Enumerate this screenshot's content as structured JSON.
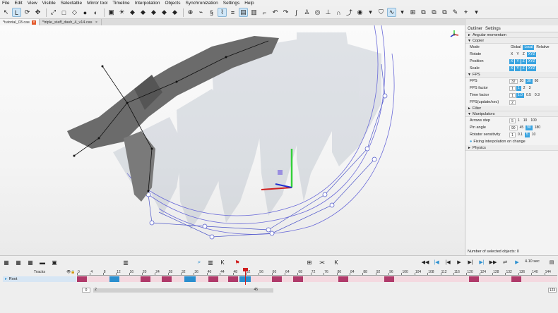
{
  "menu": [
    "File",
    "Edit",
    "View",
    "Visible",
    "Selectable",
    "Mirror tool",
    "Timeline",
    "Interpolation",
    "Objects",
    "Synchronization",
    "Settings",
    "Help"
  ],
  "toolbar_icons": [
    "select-icon",
    "lasso-icon",
    "rotate-icon",
    "move-icon",
    "scale-icon",
    "box-icon",
    "cube-icon",
    "sphere-icon",
    "mirror-icon",
    "camera-icon",
    "light-icon",
    "graph-icon",
    "curve-icon",
    "key-icon",
    "lock-icon",
    "chain-icon",
    "magnet-icon",
    "target-icon",
    "shield-icon",
    "wave-icon",
    "grid-icon",
    "layers-icon",
    "arrow-icon"
  ],
  "tabs": [
    {
      "label": "*tutorial_03.cas"
    },
    {
      "label": "*triple_staff_dash_4_v14.cas"
    }
  ],
  "panel": {
    "tabs": [
      "Outliner",
      "Settings"
    ],
    "sections": {
      "angular": "Angular momentum",
      "copier": "Copier",
      "fps": "FPS",
      "filter": "Filter",
      "manipulators": "Manipulators",
      "physics": "Physics"
    },
    "copier_rows": {
      "mode": {
        "label": "Mode",
        "opts": [
          "Global",
          "Local",
          "Relative"
        ]
      },
      "rotate": {
        "label": "Rotate",
        "opts": [
          "X",
          "Y",
          "Z",
          "XYZ"
        ]
      },
      "position": {
        "label": "Position",
        "opts": [
          "X",
          "Y",
          "Z",
          "XYZ"
        ]
      },
      "scale": {
        "label": "Scale",
        "opts": [
          "X",
          "Y",
          "Z",
          "XYZ"
        ]
      }
    },
    "fps_rows": {
      "fps": {
        "label": "FPS",
        "box": "32",
        "opts": [
          "20",
          "30",
          "60"
        ]
      },
      "factor": {
        "label": "FPS factor",
        "box": "1",
        "opts": [
          "1",
          "2",
          "3"
        ]
      },
      "time": {
        "label": "Time factor",
        "box": "1",
        "opts": [
          "1.0",
          "0.5",
          "0.3"
        ]
      },
      "update": {
        "label": "FPS(update/sec)",
        "box": "2"
      }
    },
    "manip_rows": {
      "arrows": {
        "label": "Arrows step",
        "box": "5",
        "opts": [
          "1",
          "10",
          "100"
        ]
      },
      "pin": {
        "label": "Pin angle",
        "box": "90",
        "opts": [
          "45",
          "90",
          "180"
        ]
      },
      "rot": {
        "label": "Rotator sensitivity",
        "box": "1",
        "opts": [
          "0.1",
          "5",
          "10"
        ]
      },
      "fixing": "Fixing interpolation on change"
    },
    "status": "Number of selected objects: 0"
  },
  "timeline": {
    "tracks_label": "Tracks",
    "root_label": "Root",
    "ticks": [
      "0",
      "4",
      "8",
      "12",
      "16",
      "20",
      "24",
      "28",
      "32",
      "36",
      "40",
      "44",
      "48",
      "52",
      "56",
      "60",
      "64",
      "68",
      "72",
      "76",
      "80",
      "84",
      "88",
      "92",
      "96",
      "100",
      "104",
      "108",
      "112",
      "116",
      "120",
      "124",
      "128",
      "132",
      "136",
      "140",
      "144"
    ],
    "time": "4.10 sec",
    "start": "0",
    "range_start": "2",
    "range_end": "45",
    "end": "123"
  },
  "colors": {
    "accent": "#3aa4e0",
    "track_pink": "#f4d9e0",
    "key_magenta": "#b03a6a",
    "key_blue": "#2a8fcf",
    "playhead": "#d02020"
  }
}
